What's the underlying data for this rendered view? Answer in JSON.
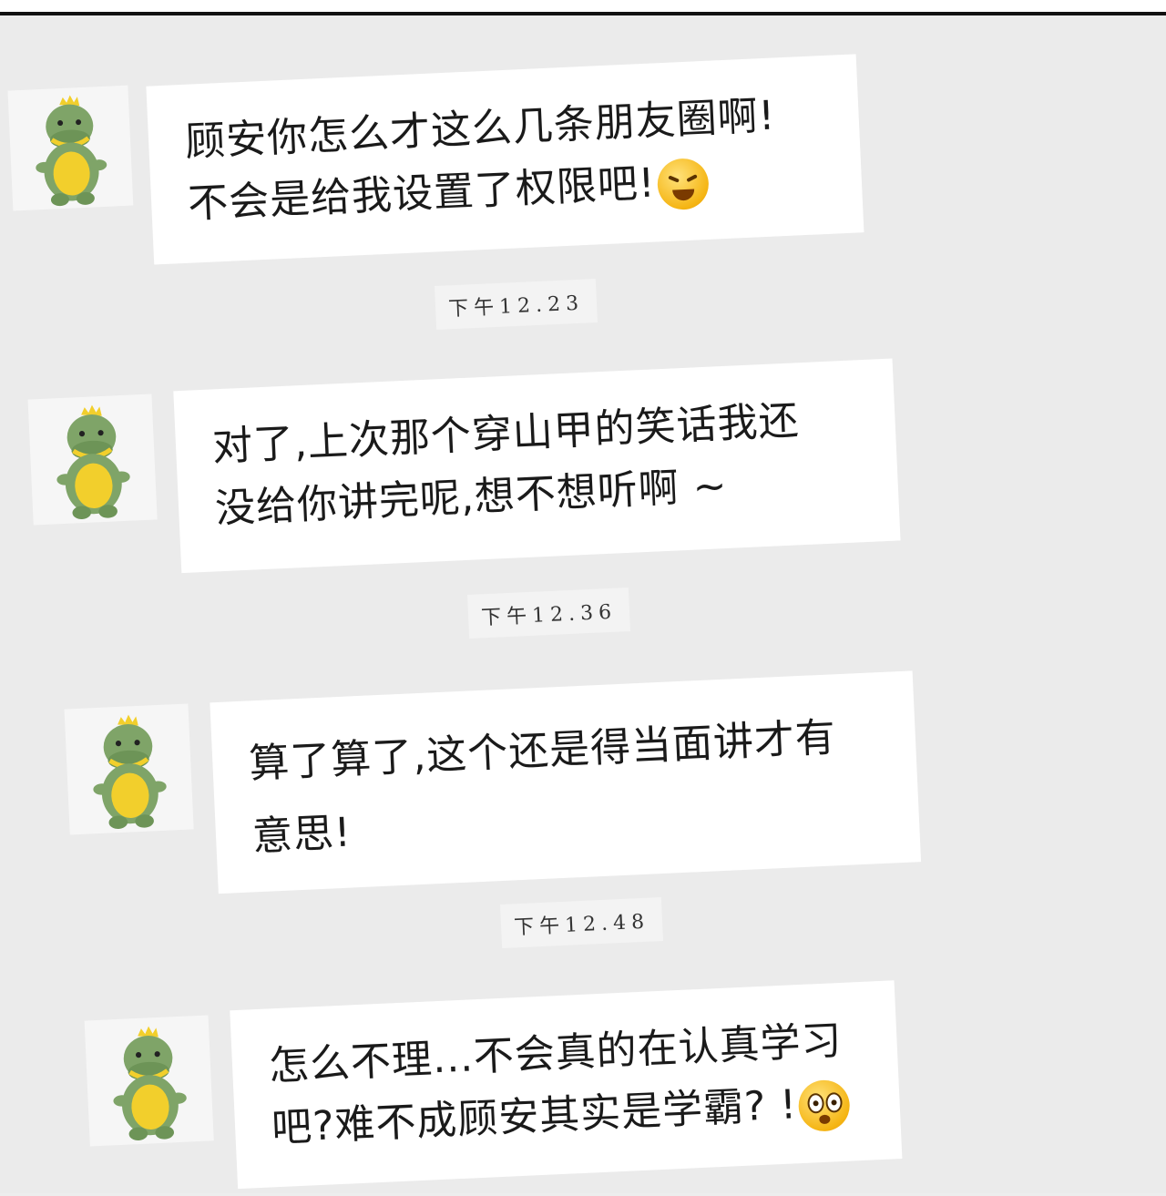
{
  "messages": [
    {
      "lines": [
        "顾安你怎么才这么几条朋友圈啊!",
        "不会是给我设置了权限吧!"
      ],
      "emoji": "laughing-crying-emoji"
    },
    {
      "lines": [
        "对了,上次那个穿山甲的笑话我还",
        "没给你讲完呢,想不想听啊 ~"
      ]
    },
    {
      "lines": [
        "算了算了,这个还是得当面讲才有",
        "意思!"
      ]
    },
    {
      "lines": [
        "怎么不理...不会真的在认真学习",
        "吧?难不成顾安其实是学霸? !"
      ],
      "emoji": "shocked-emoji"
    }
  ],
  "timestamps": [
    "下午12.23",
    "下午12.36",
    "下午12.48"
  ],
  "colors": {
    "background": "#ebebeb",
    "bubble": "#ffffff",
    "text": "#1a1a1a",
    "avatar_body": "#7fa468",
    "avatar_belly": "#f2cf2c"
  }
}
